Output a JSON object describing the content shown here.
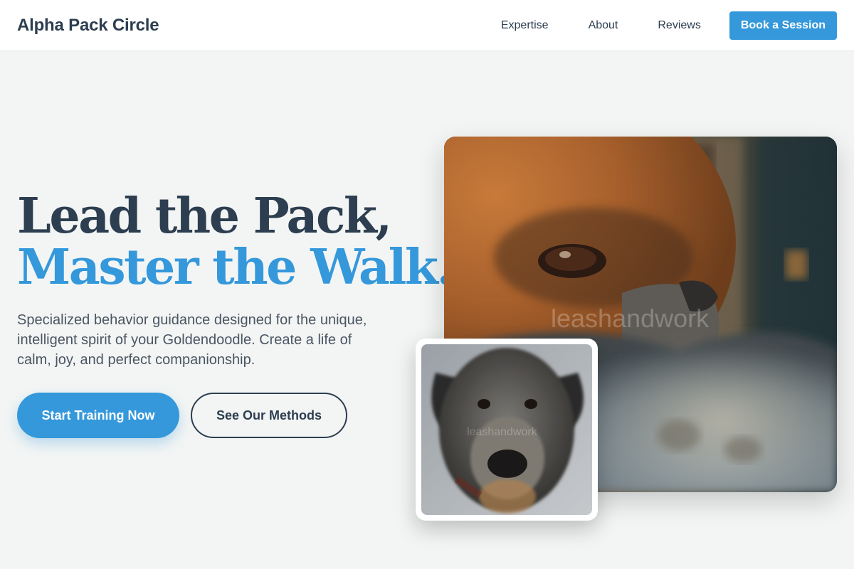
{
  "header": {
    "brand": "Alpha Pack Circle",
    "nav": [
      {
        "label": "Expertise"
      },
      {
        "label": "About"
      },
      {
        "label": "Reviews"
      }
    ],
    "cta_label": "Book a Session"
  },
  "hero": {
    "title_line1": "Lead the Pack,",
    "title_line2": "Master the Walk.",
    "subtitle": "Specialized behavior guidance designed for the unique, intelligent spirit of your Goldendoodle. Create a life of calm, joy, and perfect companionship.",
    "primary_button": "Start Training Now",
    "secondary_button": "See Our Methods"
  },
  "images": {
    "main": {
      "watermark": "leashandwork",
      "subject": "close-up of a brown dog resting on a fluffy blanket"
    },
    "inset": {
      "watermark": "leashandwork",
      "subject": "grey scruffy wolfhound-type dog portrait"
    }
  },
  "colors": {
    "accent": "#3498db",
    "dark": "#2c3e50",
    "background": "#f3f5f4"
  }
}
